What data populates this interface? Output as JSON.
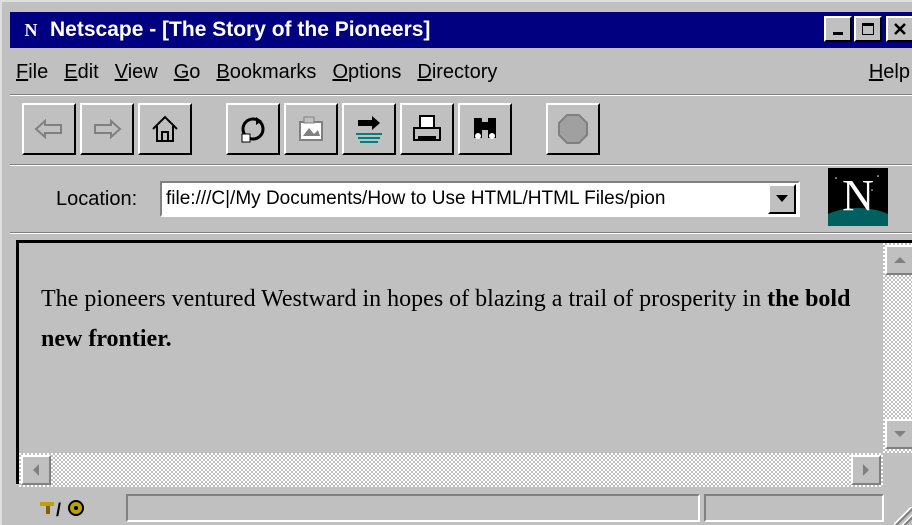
{
  "window": {
    "title": "Netscape - [The Story of the Pioneers]",
    "app_icon_text": "N",
    "controls": {
      "minimize": "_",
      "maximize": "□",
      "close": "×"
    }
  },
  "menu": {
    "items": [
      "File",
      "Edit",
      "View",
      "Go",
      "Bookmarks",
      "Options",
      "Directory"
    ],
    "help": "Help"
  },
  "toolbar": {
    "buttons": [
      "back-icon",
      "forward-icon",
      "home-icon",
      "reload-icon",
      "images-icon",
      "open-icon",
      "print-icon",
      "find-icon",
      "stop-icon"
    ]
  },
  "location": {
    "label": "Location:",
    "value": "file:///C|/My Documents/How to Use HTML/HTML Files/pion"
  },
  "document": {
    "text_plain": "The pioneers ventured Westward in hopes of blazing a trail of prosperity in ",
    "text_bold": "the bold new frontier."
  },
  "colors": {
    "titlebar": "#000080",
    "chrome": "#c0c0c0"
  }
}
